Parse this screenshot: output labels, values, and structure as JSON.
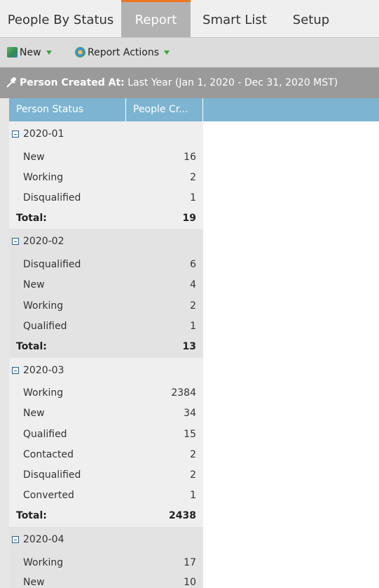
{
  "tabs": [
    {
      "label": "People By Status"
    },
    {
      "label": "Report"
    },
    {
      "label": "Smart List"
    },
    {
      "label": "Setup"
    }
  ],
  "toolbar": {
    "new_label": "New",
    "actions_label": "Report Actions"
  },
  "filter": {
    "label": "Person Created At:",
    "value": "Last Year (Jan 1, 2020 - Dec 31, 2020 MST)"
  },
  "columns": [
    {
      "label": "Person Status"
    },
    {
      "label": "People Cr..."
    }
  ],
  "groups": [
    {
      "name": "2020-01",
      "rows": [
        {
          "status": "New",
          "count": "16"
        },
        {
          "status": "Working",
          "count": "2"
        },
        {
          "status": "Disqualified",
          "count": "1"
        }
      ],
      "total_label": "Total:",
      "total": "19"
    },
    {
      "name": "2020-02",
      "rows": [
        {
          "status": "Disqualified",
          "count": "6"
        },
        {
          "status": "New",
          "count": "4"
        },
        {
          "status": "Working",
          "count": "2"
        },
        {
          "status": "Qualified",
          "count": "1"
        }
      ],
      "total_label": "Total:",
      "total": "13"
    },
    {
      "name": "2020-03",
      "rows": [
        {
          "status": "Working",
          "count": "2384"
        },
        {
          "status": "New",
          "count": "34"
        },
        {
          "status": "Qualified",
          "count": "15"
        },
        {
          "status": "Contacted",
          "count": "2"
        },
        {
          "status": "Disqualified",
          "count": "2"
        },
        {
          "status": "Converted",
          "count": "1"
        }
      ],
      "total_label": "Total:",
      "total": "2438"
    },
    {
      "name": "2020-04",
      "rows": [
        {
          "status": "Working",
          "count": "17"
        },
        {
          "status": "New",
          "count": "10"
        }
      ]
    }
  ]
}
